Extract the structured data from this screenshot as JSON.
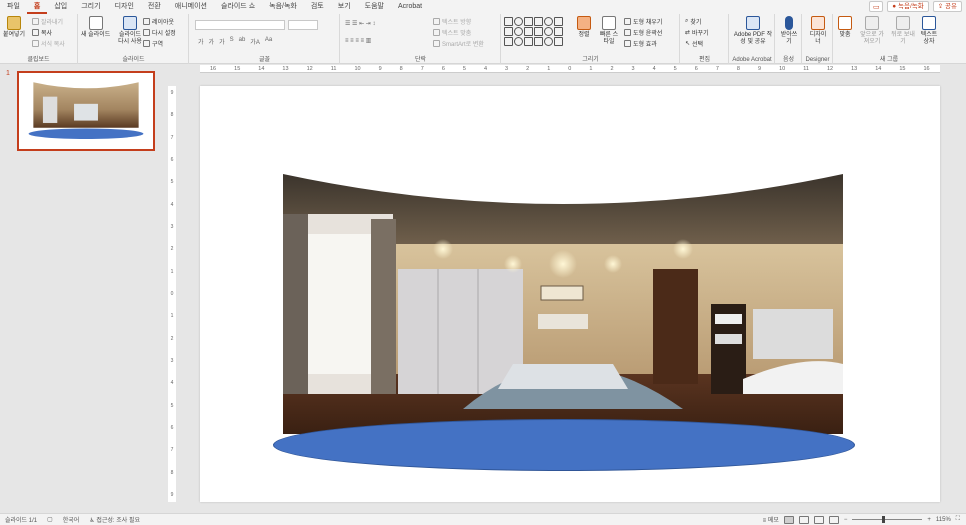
{
  "menu": {
    "tabs": [
      "파일",
      "홈",
      "삽입",
      "그리기",
      "디자인",
      "전환",
      "애니메이션",
      "슬라이드 쇼",
      "녹음/녹화",
      "검토",
      "보기",
      "도움말",
      "Acrobat"
    ],
    "active_tab": "홈",
    "record_label": "녹음/녹화",
    "share_label": "공유"
  },
  "ribbon": {
    "clipboard": {
      "paste": "붙여넣기",
      "cut": "잘라내기",
      "copy": "복사",
      "format_painter": "서식 복사",
      "label": "클립보드"
    },
    "slides": {
      "new_slide": "새 슬라이드",
      "reuse": "슬라이드 다시 사용",
      "layout": "레이아웃",
      "reset": "다시 설정",
      "section": "구역",
      "label": "슬라이드"
    },
    "font": {
      "label": "글꼴",
      "row2": [
        "가",
        "가",
        "가",
        "S",
        "ab",
        "가A",
        "Aa"
      ]
    },
    "paragraph": {
      "text_direction": "텍스트 방향",
      "align_text": "텍스트 맞춤",
      "smartart": "SmartArt로 변환",
      "label": "단락"
    },
    "drawing": {
      "arrange": "정렬",
      "quick_styles": "빠른 스타일",
      "fill": "도형 채우기",
      "outline": "도형 윤곽선",
      "effects": "도형 효과",
      "label": "그리기"
    },
    "editing": {
      "find": "찾기",
      "replace": "바꾸기",
      "select": "선택",
      "label": "편집"
    },
    "acrobat": {
      "create_pdf": "Adobe PDF 작성 및 공유",
      "label": "Adobe Acrobat"
    },
    "voice": {
      "dictate": "받아쓰기",
      "label": "음성"
    },
    "designer": {
      "ideas": "디자이너",
      "label": "Designer"
    },
    "new_group": {
      "arrange": "맞춤",
      "bring_forward": "앞으로 가져오기",
      "send_backward": "뒤로 보내기",
      "textbox": "텍스트 상자",
      "label": "새 그룹"
    }
  },
  "slides_panel": {
    "slide_number": "1"
  },
  "rulers": {
    "h_ticks": [
      "16",
      "15",
      "14",
      "13",
      "12",
      "11",
      "10",
      "9",
      "8",
      "7",
      "6",
      "5",
      "4",
      "3",
      "2",
      "1",
      "0",
      "1",
      "2",
      "3",
      "4",
      "5",
      "6",
      "7",
      "8",
      "9",
      "10",
      "11",
      "12",
      "13",
      "14",
      "15",
      "16"
    ],
    "v_ticks": [
      "9",
      "8",
      "7",
      "6",
      "5",
      "4",
      "3",
      "2",
      "1",
      "0",
      "1",
      "2",
      "3",
      "4",
      "5",
      "6",
      "7",
      "8",
      "9"
    ]
  },
  "status": {
    "slide_info": "슬라이드 1/1",
    "language": "한국어",
    "accessibility": "접근성: 조사 필요",
    "notes": "메모",
    "zoom": "115%"
  },
  "colors": {
    "accent": "#c43e1c",
    "ellipse_fill": "#4472c4"
  }
}
